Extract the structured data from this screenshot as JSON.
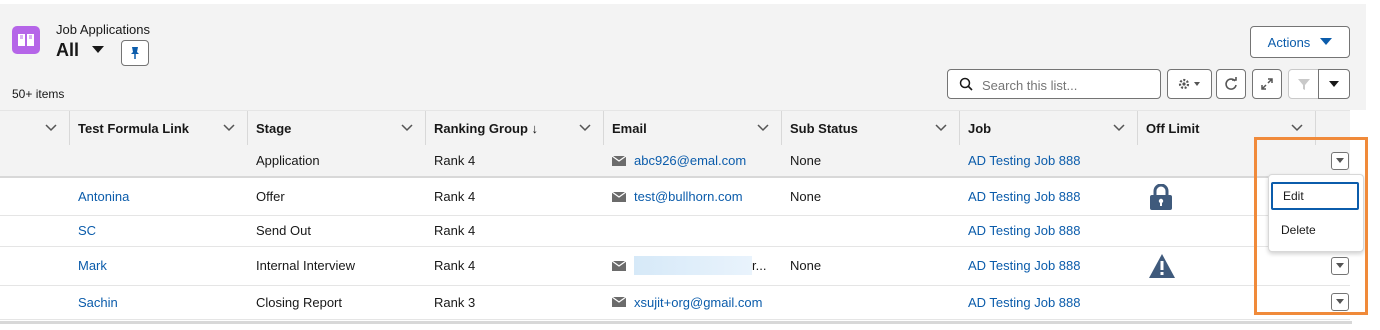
{
  "header": {
    "object_title": "Job Applications",
    "list_name": "All",
    "items_count": "50+ items",
    "actions_label": "Actions",
    "search_placeholder": "Search this list...",
    "icon_color": "#b565e8"
  },
  "columns": [
    {
      "label": ""
    },
    {
      "label": "Test Formula Link"
    },
    {
      "label": "Stage"
    },
    {
      "label": "Ranking Group ↓"
    },
    {
      "label": "Email"
    },
    {
      "label": "Sub Status"
    },
    {
      "label": "Job"
    },
    {
      "label": "Off Limit"
    }
  ],
  "rows": [
    {
      "link": "",
      "stage": "Application",
      "rank": "Rank 4",
      "email": "abc926@emal.com",
      "sub_status": "None",
      "job": "AD Testing Job 888",
      "off_limit_icon": ""
    },
    {
      "link": "Antonina",
      "stage": "Offer",
      "rank": "Rank 4",
      "email": "test@bullhorn.com",
      "sub_status": "None",
      "job": "AD Testing Job 888",
      "off_limit_icon": "lock-icon"
    },
    {
      "link": "SC",
      "stage": "Send Out",
      "rank": "Rank 4",
      "email": "",
      "sub_status": "",
      "job": "AD Testing Job 888",
      "off_limit_icon": ""
    },
    {
      "link": "Mark",
      "stage": "Internal Interview",
      "rank": "Rank 4",
      "email": "r...",
      "sub_status": "None",
      "job": "AD Testing Job 888",
      "off_limit_icon": "warning-icon"
    },
    {
      "link": "Sachin",
      "stage": "Closing Report",
      "rank": "Rank 3",
      "email": "xsujit+org@gmail.com",
      "sub_status": "",
      "job": "AD Testing Job 888",
      "off_limit_icon": ""
    }
  ],
  "row_menu": {
    "edit_label": "Edit",
    "delete_label": "Delete"
  },
  "colors": {
    "link": "#0b5cab",
    "highlight": "#f08a3a"
  }
}
